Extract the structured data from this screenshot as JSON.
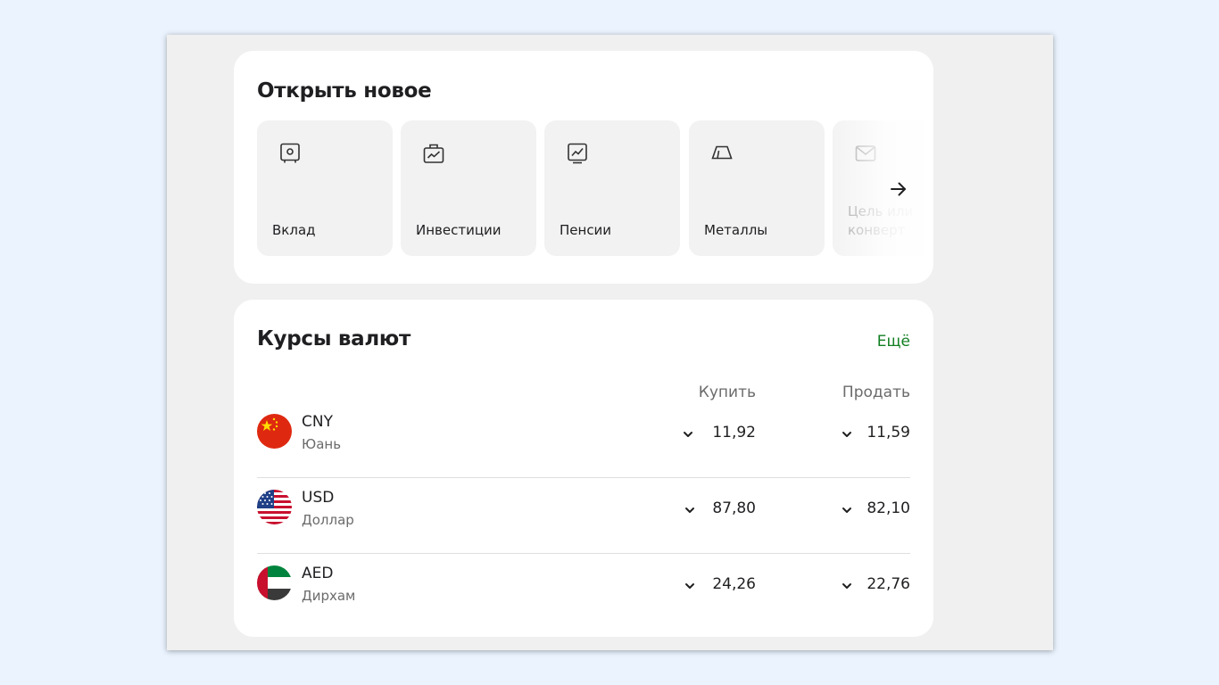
{
  "open_new": {
    "title": "Открыть новое",
    "tiles": [
      {
        "label": "Вклад",
        "icon": "safe-icon"
      },
      {
        "label": "Инвестиции",
        "icon": "briefcase-chart-icon"
      },
      {
        "label": "Пенсии",
        "icon": "chart-up-icon"
      },
      {
        "label": "Металлы",
        "icon": "gold-bar-icon"
      },
      {
        "label": "Цель или конверт",
        "icon": "envelope-icon"
      }
    ],
    "scroll_icon": "arrow-right-icon"
  },
  "rates": {
    "title": "Курсы валют",
    "more_label": "Ещё",
    "more_color": "#107f21",
    "buy_header": "Купить",
    "sell_header": "Продать",
    "rows": [
      {
        "code": "CNY",
        "name": "Юань",
        "buy": "11,92",
        "sell": "11,59",
        "trend_icon": "chevron-down-icon"
      },
      {
        "code": "USD",
        "name": "Доллар",
        "buy": "87,80",
        "sell": "82,10",
        "trend_icon": "chevron-down-icon"
      },
      {
        "code": "AED",
        "name": "Дирхам",
        "buy": "24,26",
        "sell": "22,76",
        "trend_icon": "chevron-down-icon"
      }
    ]
  }
}
